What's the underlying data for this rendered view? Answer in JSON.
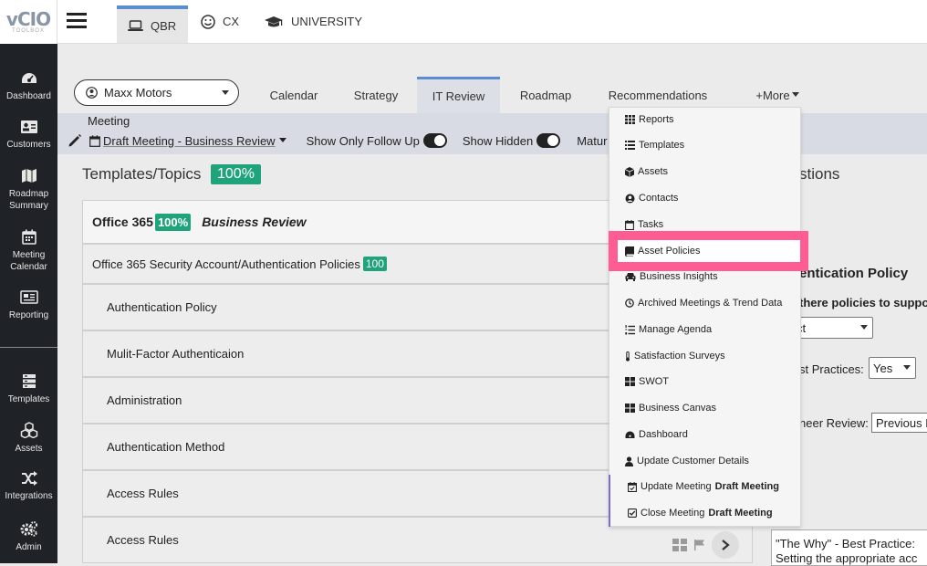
{
  "logo": {
    "text": "vCIO",
    "sub": "TOOLBOX"
  },
  "sidebar": {
    "items": [
      {
        "label": "Dashboard",
        "icon": "dashboard-icon"
      },
      {
        "label": "Customers",
        "icon": "address-card-icon"
      },
      {
        "label": "Roadmap Summary",
        "icon": "map-icon"
      },
      {
        "label": "Meeting Calendar",
        "icon": "calendar-icon"
      },
      {
        "label": "Reporting",
        "icon": "newspaper-icon"
      },
      {
        "label": "Templates",
        "icon": "layers-icon"
      },
      {
        "label": "Assets",
        "icon": "cubes-icon"
      },
      {
        "label": "Integrations",
        "icon": "random-icon"
      },
      {
        "label": "Admin",
        "icon": "cogs-icon"
      }
    ]
  },
  "topbar": {
    "tabs": [
      {
        "label": "QBR",
        "icon": "laptop-icon"
      },
      {
        "label": "CX",
        "icon": "smile-icon"
      },
      {
        "label": "UNIVERSITY",
        "icon": "graduation-cap-icon"
      }
    ]
  },
  "customer": {
    "name": "Maxx Motors"
  },
  "nav": {
    "tabs": [
      "Calendar",
      "Strategy",
      "IT Review",
      "Roadmap",
      "Recommendations"
    ],
    "more": "+More"
  },
  "meeting": {
    "label": "Meeting",
    "selected": "Draft Meeting - Business Review",
    "follow_up": "Show Only Follow Up",
    "show_hidden": "Show Hidden",
    "maturity": "Matur"
  },
  "templates": {
    "title": "Templates/Topics",
    "percent": "100%"
  },
  "questions": {
    "title": "stions"
  },
  "rows": {
    "group": {
      "name": "Office 365",
      "percent": "100%",
      "subtitle": "Business Review"
    },
    "category": {
      "name": "Office 365 Security Account/Authentication Policies",
      "percent": "100"
    },
    "items": [
      "Authentication Policy",
      "Mulit-Factor Authenticaion",
      "Administration",
      "Authentication Method",
      "Access Rules",
      "Access Rules"
    ]
  },
  "right_panel": {
    "heading": "entication Policy",
    "question": "there policies to suppo",
    "select1": "ct",
    "best_practices_label": "st Practices:",
    "best_practices_value": "Yes",
    "engineer_label": "neer Review:",
    "engineer_value": "Previous R",
    "why_line1": "\"The Why\" - Best Practice:",
    "why_line2": "Setting the appropriate acc"
  },
  "more_menu": {
    "items": [
      {
        "label": "Reports",
        "icon": "th-icon"
      },
      {
        "label": "Templates",
        "icon": "list-icon"
      },
      {
        "label": "Assets",
        "icon": "cube-icon"
      },
      {
        "label": "Contacts",
        "icon": "user-circle-icon"
      },
      {
        "label": "Tasks",
        "icon": "calendar-icon"
      },
      {
        "label": "Asset Policies",
        "icon": "book-icon"
      },
      {
        "label": "Business Insights",
        "icon": "car-icon"
      },
      {
        "label": "Archived Meetings & Trend Data",
        "icon": "clock-icon"
      },
      {
        "label": "Manage Agenda",
        "icon": "list-ol-icon"
      },
      {
        "label": "Satisfaction Surveys",
        "icon": "thermometer-icon"
      },
      {
        "label": "SWOT",
        "icon": "th-large-icon"
      },
      {
        "label": "Business Canvas",
        "icon": "th-large-icon"
      },
      {
        "label": "Dashboard",
        "icon": "dashboard-icon"
      },
      {
        "label": "Update Customer Details",
        "icon": "user-icon"
      },
      {
        "label": "Update Meeting",
        "bold": "Draft Meeting",
        "icon": "calendar-check-icon"
      },
      {
        "label": "Close Meeting",
        "bold": "Draft Meeting",
        "icon": "check-square-icon"
      }
    ]
  },
  "colors": {
    "accent": "#5b8ed1",
    "badge": "#1fa37a",
    "highlight": "#ff5c93",
    "sidebar": "#1f2227"
  }
}
